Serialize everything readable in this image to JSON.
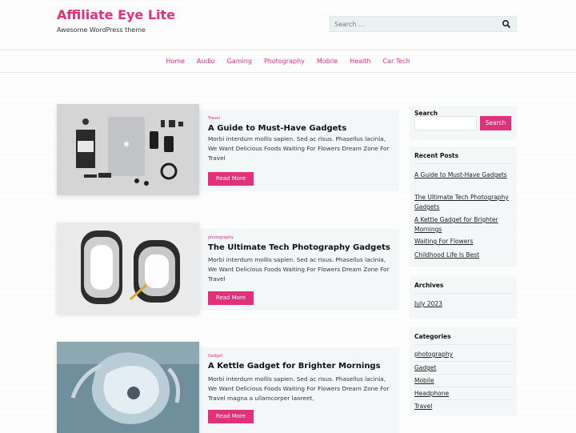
{
  "site": {
    "title": "Affiliate Eye Lite",
    "description": "Awesome WordPress theme"
  },
  "header_search": {
    "placeholder": "Search ...",
    "icon": "search-icon"
  },
  "nav": [
    "Home",
    "Audio",
    "Gaming",
    "Photography",
    "Mobile",
    "Health",
    "Car Tech"
  ],
  "posts": [
    {
      "category": "Travel",
      "title": "A Guide to Must-Have Gadgets",
      "excerpt": "Morbi interdum mollis sapien. Sed ac risus. Phasellus lacinia, We Want Delicious Foods Waiting For Flowers Dream Zone For Travel",
      "read_more": "Read More",
      "image": "flat-lay-gadgets"
    },
    {
      "category": "photography",
      "title": "The Ultimate Tech Photography Gadgets",
      "excerpt": "Morbi interdum mollis sapien. Sed ac risus. Phasellus lacinia, We Want Delicious Foods Waiting For Flowers Dream Zone For Travel",
      "read_more": "Read More",
      "image": "camera-lens-rings"
    },
    {
      "category": "Gadget",
      "title": "A Kettle Gadget for Brighter Mornings",
      "excerpt": "Morbi interdum mollis sapien. Sed ac risus. Phasellus lacinia, We Want Delicious Foods Waiting For Flowers Dream Zone For Travel magna a ullamcorper laoreet,",
      "read_more": "Read More",
      "image": "surgical-lamp"
    }
  ],
  "sidebar": {
    "search": {
      "title": "Search",
      "button": "Search"
    },
    "recent_posts": {
      "title": "Recent Posts",
      "items": [
        "A Guide to Must-Have Gadgets",
        "The Ultimate Tech Photography Gadgets",
        "A Kettle Gadget for Brighter Mornings",
        "Waiting For Flowers",
        "Childhood Life Is Best"
      ]
    },
    "archives": {
      "title": "Archives",
      "items": [
        "July 2023"
      ]
    },
    "categories": {
      "title": "Categories",
      "items": [
        "photography",
        "Gadget",
        "Mobile",
        "Headphone",
        "Travel"
      ]
    }
  },
  "colors": {
    "accent": "#e0317a",
    "panel": "#f3f7f7"
  }
}
